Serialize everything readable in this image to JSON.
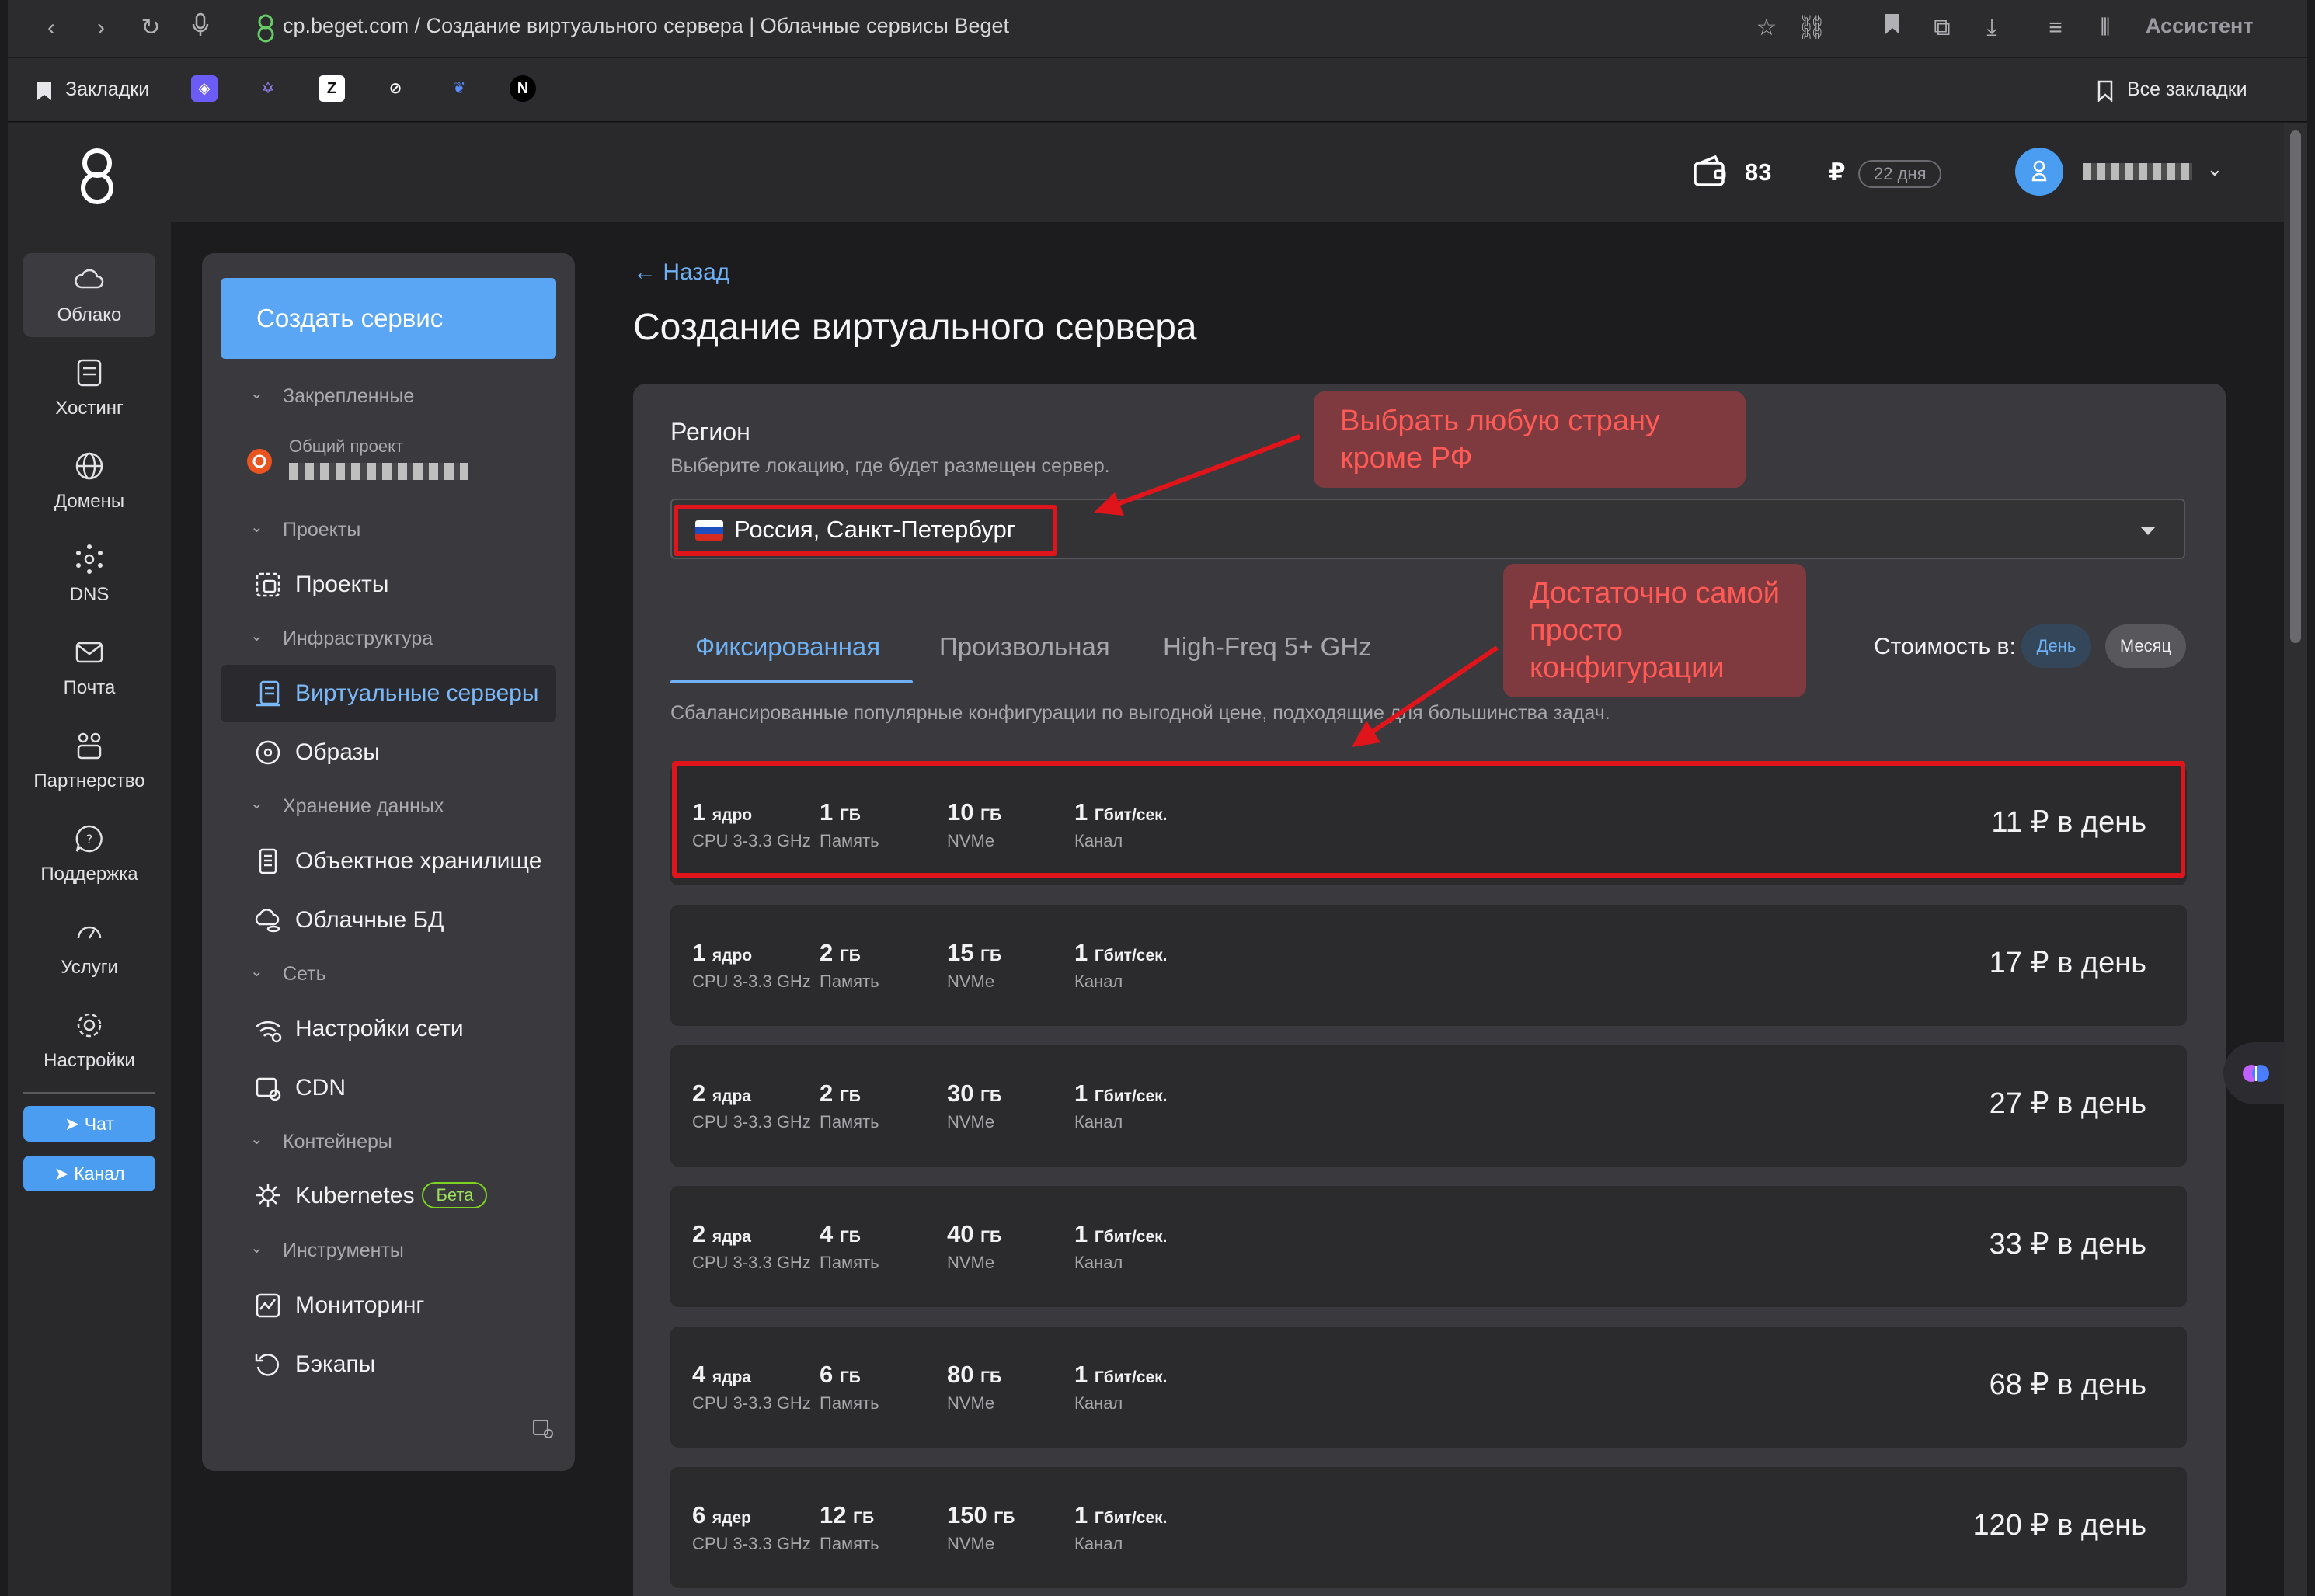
{
  "browser": {
    "url": "cp.beget.com / Создание виртуального сервера | Облачные сервисы Beget",
    "assistant": "Ассистент",
    "bookmarks_label": "Закладки",
    "all_bookmarks": "Все закладки"
  },
  "header": {
    "balance": "83",
    "currency": "₽",
    "days_left": "22 дня"
  },
  "rail": {
    "items": [
      {
        "label": "Облако"
      },
      {
        "label": "Хостинг"
      },
      {
        "label": "Домены"
      },
      {
        "label": "DNS"
      },
      {
        "label": "Почта"
      },
      {
        "label": "Партнерство"
      },
      {
        "label": "Поддержка"
      },
      {
        "label": "Услуги"
      },
      {
        "label": "Настройки"
      }
    ],
    "chat": "Чат",
    "channel": "Канал"
  },
  "nav": {
    "create": "Создать сервис",
    "pinned": "Закрепленные",
    "shared_project": "Общий проект",
    "projects_section": "Проекты",
    "projects": "Проекты",
    "infra_section": "Инфраструктура",
    "vps": "Виртуальные серверы",
    "images": "Образы",
    "storage_section": "Хранение данных",
    "object_storage": "Объектное хранилище",
    "cloud_db": "Облачные БД",
    "network_section": "Сеть",
    "network_settings": "Настройки сети",
    "cdn": "CDN",
    "containers_section": "Контейнеры",
    "kubernetes": "Kubernetes",
    "beta": "Бета",
    "tools_section": "Инструменты",
    "monitoring": "Мониторинг",
    "backups": "Бэкапы"
  },
  "main": {
    "back": "← Назад",
    "title": "Создание виртуального сервера",
    "region_title": "Регион",
    "region_sub": "Выберите локацию, где будет размещен сервер.",
    "region_value": "Россия, Санкт-Петербург",
    "tabs": [
      "Фиксированная",
      "Произвольная",
      "High-Freq 5+ GHz"
    ],
    "cost_label": "Стоимость в:",
    "cost_day": "День",
    "cost_month": "Месяц",
    "tab_desc": "Сбалансированные популярные конфигурации по выгодной цене, подходящие для большинства задач.",
    "configs": [
      {
        "cpu": "1",
        "cpu_unit": "ядро",
        "cpu_sub": "CPU 3-3.3 GHz",
        "ram": "1",
        "ram_unit": "ГБ",
        "ram_sub": "Память",
        "disk": "10",
        "disk_unit": "ГБ",
        "disk_sub": "NVMe",
        "net": "1",
        "net_unit": "Гбит/сек.",
        "net_sub": "Канал",
        "price": "11 ₽ в день"
      },
      {
        "cpu": "1",
        "cpu_unit": "ядро",
        "cpu_sub": "CPU 3-3.3 GHz",
        "ram": "2",
        "ram_unit": "ГБ",
        "ram_sub": "Память",
        "disk": "15",
        "disk_unit": "ГБ",
        "disk_sub": "NVMe",
        "net": "1",
        "net_unit": "Гбит/сек.",
        "net_sub": "Канал",
        "price": "17 ₽ в день"
      },
      {
        "cpu": "2",
        "cpu_unit": "ядра",
        "cpu_sub": "CPU 3-3.3 GHz",
        "ram": "2",
        "ram_unit": "ГБ",
        "ram_sub": "Память",
        "disk": "30",
        "disk_unit": "ГБ",
        "disk_sub": "NVMe",
        "net": "1",
        "net_unit": "Гбит/сек.",
        "net_sub": "Канал",
        "price": "27 ₽ в день"
      },
      {
        "cpu": "2",
        "cpu_unit": "ядра",
        "cpu_sub": "CPU 3-3.3 GHz",
        "ram": "4",
        "ram_unit": "ГБ",
        "ram_sub": "Память",
        "disk": "40",
        "disk_unit": "ГБ",
        "disk_sub": "NVMe",
        "net": "1",
        "net_unit": "Гбит/сек.",
        "net_sub": "Канал",
        "price": "33 ₽ в день"
      },
      {
        "cpu": "4",
        "cpu_unit": "ядра",
        "cpu_sub": "CPU 3-3.3 GHz",
        "ram": "6",
        "ram_unit": "ГБ",
        "ram_sub": "Память",
        "disk": "80",
        "disk_unit": "ГБ",
        "disk_sub": "NVMe",
        "net": "1",
        "net_unit": "Гбит/сек.",
        "net_sub": "Канал",
        "price": "68 ₽ в день"
      },
      {
        "cpu": "6",
        "cpu_unit": "ядер",
        "cpu_sub": "CPU 3-3.3 GHz",
        "ram": "12",
        "ram_unit": "ГБ",
        "ram_sub": "Память",
        "disk": "150",
        "disk_unit": "ГБ",
        "disk_sub": "NVMe",
        "net": "1",
        "net_unit": "Гбит/сек.",
        "net_sub": "Канал",
        "price": "120 ₽ в день"
      }
    ]
  },
  "annotations": {
    "region_note": "Выбрать любую страну кроме РФ",
    "config_note": "Достаточно самой просто конфигурации"
  },
  "colors": {
    "accent": "#5aa6f5",
    "annotation": "#e0151c"
  }
}
